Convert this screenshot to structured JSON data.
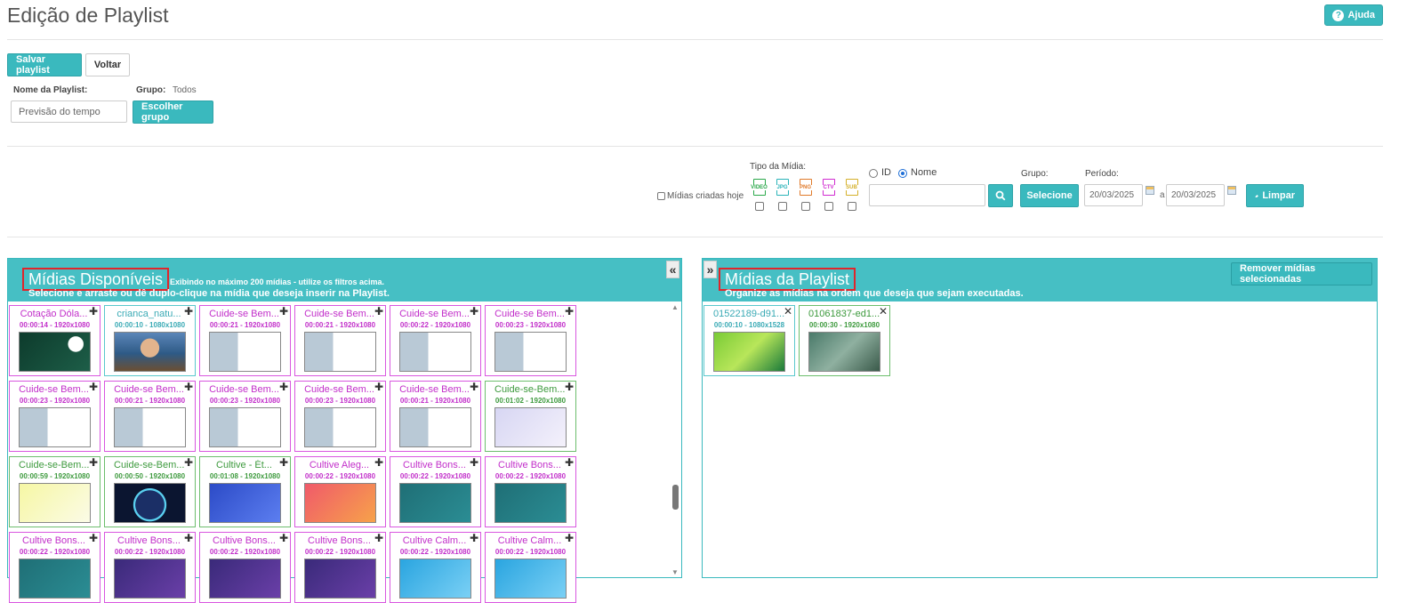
{
  "page": {
    "title": "Edição de Playlist",
    "help_label": "Ajuda"
  },
  "toolbar": {
    "save_label": "Salvar playlist",
    "back_label": "Voltar"
  },
  "playlist_form": {
    "name_label": "Nome da Playlist:",
    "name_placeholder": "Previsão do tempo",
    "group_label": "Grupo:",
    "group_value": "Todos",
    "choose_group_label": "Escolher grupo"
  },
  "filters": {
    "today_label": "Mídias criadas hoje",
    "media_type_label": "Tipo da Mídia:",
    "media_types": [
      "VIDEO",
      "JPG",
      "PNG",
      "CTV",
      "SUB"
    ],
    "media_type_colors": [
      "#2aa84a",
      "#2ab3b8",
      "#e07a2a",
      "#d02ad0",
      "#d4b02a"
    ],
    "search_by_id": "ID",
    "search_by_name": "Nome",
    "search_mode": "Nome",
    "group_label": "Grupo:",
    "group_button": "Selecione",
    "period_label": "Período:",
    "date_from": "20/03/2025",
    "date_sep": "a",
    "date_to": "20/03/2025",
    "clear_label": "Limpar"
  },
  "available": {
    "title": "Mídias Disponíveis",
    "note": "Exibindo no máximo 200 mídias - utilize os filtros acima.",
    "subtitle": "Selecione e arraste ou dê duplo-clique na mídia que deseja inserir na Playlist.",
    "collapse_icon": "«",
    "items": [
      {
        "name": "Cotação Dóla...",
        "meta": "00:00:14 - 1920x1080",
        "color": "pink",
        "thumb": "dark-green"
      },
      {
        "name": "crianca_natu...",
        "meta": "00:00:10 - 1080x1080",
        "color": "blue",
        "thumb": "photo"
      },
      {
        "name": "Cuide-se Bem...",
        "meta": "00:00:21 - 1920x1080",
        "color": "pink",
        "thumb": "doc"
      },
      {
        "name": "Cuide-se Bem...",
        "meta": "00:00:21 - 1920x1080",
        "color": "pink",
        "thumb": "doc"
      },
      {
        "name": "Cuide-se Bem...",
        "meta": "00:00:22 - 1920x1080",
        "color": "pink",
        "thumb": "doc"
      },
      {
        "name": "Cuide-se Bem...",
        "meta": "00:00:23 - 1920x1080",
        "color": "pink",
        "thumb": "doc"
      },
      {
        "name": "Cuide-se Bem...",
        "meta": "00:00:23 - 1920x1080",
        "color": "pink",
        "thumb": "doc"
      },
      {
        "name": "Cuide-se Bem...",
        "meta": "00:00:21 - 1920x1080",
        "color": "pink",
        "thumb": "doc"
      },
      {
        "name": "Cuide-se Bem...",
        "meta": "00:00:23 - 1920x1080",
        "color": "pink",
        "thumb": "doc"
      },
      {
        "name": "Cuide-se Bem...",
        "meta": "00:00:23 - 1920x1080",
        "color": "pink",
        "thumb": "doc"
      },
      {
        "name": "Cuide-se Bem...",
        "meta": "00:00:21 - 1920x1080",
        "color": "pink",
        "thumb": "doc"
      },
      {
        "name": "Cuide-se-Bem...",
        "meta": "00:01:02 - 1920x1080",
        "color": "green",
        "thumb": "lavender"
      },
      {
        "name": "Cuide-se-Bem...",
        "meta": "00:00:59 - 1920x1080",
        "color": "green",
        "thumb": "yellow"
      },
      {
        "name": "Cuide-se-Bem...",
        "meta": "00:00:50 - 1920x1080",
        "color": "green",
        "thumb": "night"
      },
      {
        "name": "Cultive - Ét...",
        "meta": "00:01:08 - 1920x1080",
        "color": "green",
        "thumb": "blue-card"
      },
      {
        "name": "Cultive Aleg...",
        "meta": "00:00:22 - 1920x1080",
        "color": "pink",
        "thumb": "coral"
      },
      {
        "name": "Cultive Bons...",
        "meta": "00:00:22 - 1920x1080",
        "color": "pink",
        "thumb": "teal"
      },
      {
        "name": "Cultive Bons...",
        "meta": "00:00:22 - 1920x1080",
        "color": "pink",
        "thumb": "teal"
      },
      {
        "name": "Cultive Bons...",
        "meta": "00:00:22 - 1920x1080",
        "color": "pink",
        "thumb": "teal"
      },
      {
        "name": "Cultive Bons...",
        "meta": "00:00:22 - 1920x1080",
        "color": "pink",
        "thumb": "purple"
      },
      {
        "name": "Cultive Bons...",
        "meta": "00:00:22 - 1920x1080",
        "color": "pink",
        "thumb": "purple"
      },
      {
        "name": "Cultive Bons...",
        "meta": "00:00:22 - 1920x1080",
        "color": "pink",
        "thumb": "purple"
      },
      {
        "name": "Cultive Calm...",
        "meta": "00:00:22 - 1920x1080",
        "color": "pink",
        "thumb": "sky"
      },
      {
        "name": "Cultive Calm...",
        "meta": "00:00:22 - 1920x1080",
        "color": "pink",
        "thumb": "sky"
      }
    ]
  },
  "playlist": {
    "title": "Mídias da Playlist",
    "subtitle": "Organize as mídias na ordem que deseja que sejam executadas.",
    "expand_icon": "»",
    "remove_label": "Remover mídias selecionadas",
    "items": [
      {
        "name": "01522189-d91...",
        "meta": "00:00:10 - 1080x1528",
        "color": "blue",
        "thumb": "birthday"
      },
      {
        "name": "01061837-ed1...",
        "meta": "00:00:30 - 1920x1080",
        "color": "green",
        "thumb": "photo2"
      }
    ]
  }
}
